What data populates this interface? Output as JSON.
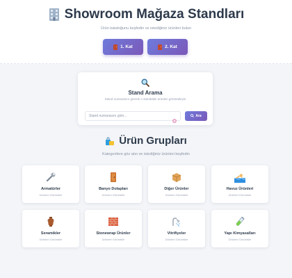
{
  "header": {
    "title": "Showroom Mağaza Standları",
    "title_icon": "office-building-icon",
    "subtitle": "Ürün kataloğunu keşfedin ve istediğiniz ürünleri bulun",
    "floors": [
      {
        "label": "1. Kat",
        "icon": "door-icon"
      },
      {
        "label": "2. Kat",
        "icon": "door-icon"
      }
    ]
  },
  "search": {
    "icon": "magnifier-icon",
    "title": "Stand Arama",
    "subtitle": "Stand numarasını girerek o standdaki ürünleri görüntüleyin",
    "placeholder": "Stand numarasını girin...",
    "value": "",
    "button_label": "Ara"
  },
  "products": {
    "title": "Ürün Grupları",
    "title_icon": "shopping-bags-icon",
    "subtitle": "Kategorilere göz atın ve istediğiniz ürünleri keşfedin",
    "card_sub": "Ürünleri Görüntüle",
    "groups": [
      {
        "name": "Armatürler",
        "icon": "wrench-icon"
      },
      {
        "name": "Banyo Dolapları",
        "icon": "cabinet-door-icon"
      },
      {
        "name": "Diğer Ürünler",
        "icon": "package-icon"
      },
      {
        "name": "Havuz Ürünleri",
        "icon": "swimmer-icon"
      },
      {
        "name": "Seramikler",
        "icon": "amphora-icon"
      },
      {
        "name": "Stonewrap Ürünler",
        "icon": "brick-icon"
      },
      {
        "name": "Vitrifiyeler",
        "icon": "shower-icon"
      },
      {
        "name": "Yapı Kimyasalları",
        "icon": "test-tube-icon"
      }
    ]
  },
  "colors": {
    "accent_start": "#6e7bdc",
    "accent_end": "#7b58b8",
    "text_dark": "#2d3a4b",
    "text_muted": "#8a94a6",
    "background": "#f3f5f8"
  }
}
